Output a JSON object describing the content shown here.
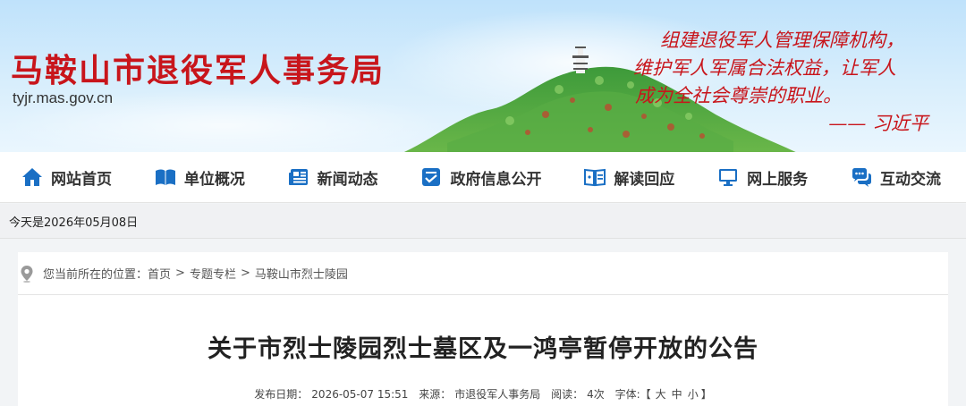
{
  "header": {
    "site_title": "马鞍山市退役军人事务局",
    "site_url": "tyjr.mas.gov.cn",
    "motto_line1": "组建退役军人管理保障机构，",
    "motto_line2": "维护军人军属合法权益，让军人",
    "motto_line3": "成为全社会尊崇的职业。",
    "motto_sign": "—— 习近平"
  },
  "nav": {
    "items": [
      {
        "label": "网站首页",
        "icon": "home-icon"
      },
      {
        "label": "单位概况",
        "icon": "book-icon"
      },
      {
        "label": "新闻动态",
        "icon": "newspaper-icon"
      },
      {
        "label": "政府信息公开",
        "icon": "info-disclosure-icon"
      },
      {
        "label": "解读回应",
        "icon": "open-book-icon"
      },
      {
        "label": "网上服务",
        "icon": "monitor-icon"
      },
      {
        "label": "互动交流",
        "icon": "chat-bubble-icon"
      }
    ]
  },
  "date_bar": {
    "text": "今天是2026年05月08日"
  },
  "breadcrumb": {
    "prefix": "您当前所在的位置：",
    "items": [
      "首页",
      "专题专栏",
      "马鞍山市烈士陵园"
    ],
    "separator": ">"
  },
  "article": {
    "title": "关于市烈士陵园烈士墓区及一鸿亭暂停开放的公告",
    "publish_label": "发布日期：",
    "publish_date": "2026-05-07 15:51",
    "source_label": "来源：",
    "source": "市退役军人事务局",
    "views_label": "阅读：",
    "views": "4次",
    "font_label": "字体:【",
    "font_large": "大",
    "font_medium": "中",
    "font_small": "小",
    "font_close": "】"
  },
  "colors": {
    "brand_red": "#c8151b",
    "nav_icon_blue": "#1a6fc4",
    "banner_sky": "#bfe2fb"
  }
}
